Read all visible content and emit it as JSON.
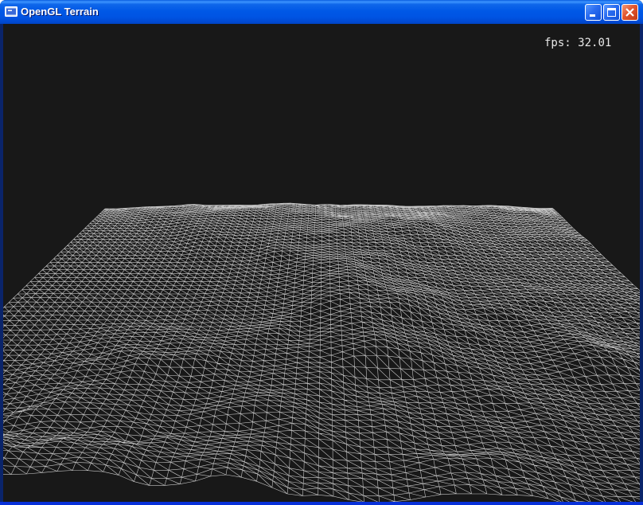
{
  "window": {
    "title": "OpenGL Terrain",
    "icon": "opengl-app-icon",
    "controls": {
      "minimize_icon": "minimize-icon",
      "maximize_icon": "maximize-icon",
      "close_icon": "close-icon"
    },
    "colors": {
      "titlebar": "#0054e3",
      "background": "#181818",
      "wireframe": "#e6e6e6"
    }
  },
  "hud": {
    "fps_label": "fps:",
    "fps_value": "32.01"
  },
  "viewport": {
    "render_mode": "wireframe",
    "scene": "terrain-heightmap"
  }
}
